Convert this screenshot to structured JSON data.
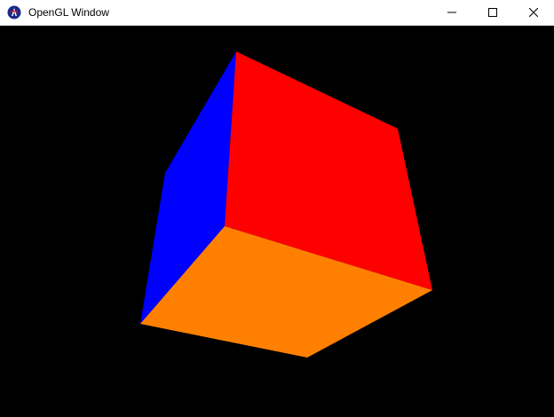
{
  "window": {
    "title": "OpenGL Window",
    "icon": "app-icon",
    "controls": [
      "minimize-icon",
      "maximize-icon",
      "close-icon"
    ]
  },
  "scene": {
    "background": "#000000",
    "object": "cube",
    "faces": [
      {
        "name": "left",
        "color": "#0000ff"
      },
      {
        "name": "front",
        "color": "#ff0000"
      },
      {
        "name": "bottom",
        "color": "#ff8000"
      }
    ]
  }
}
